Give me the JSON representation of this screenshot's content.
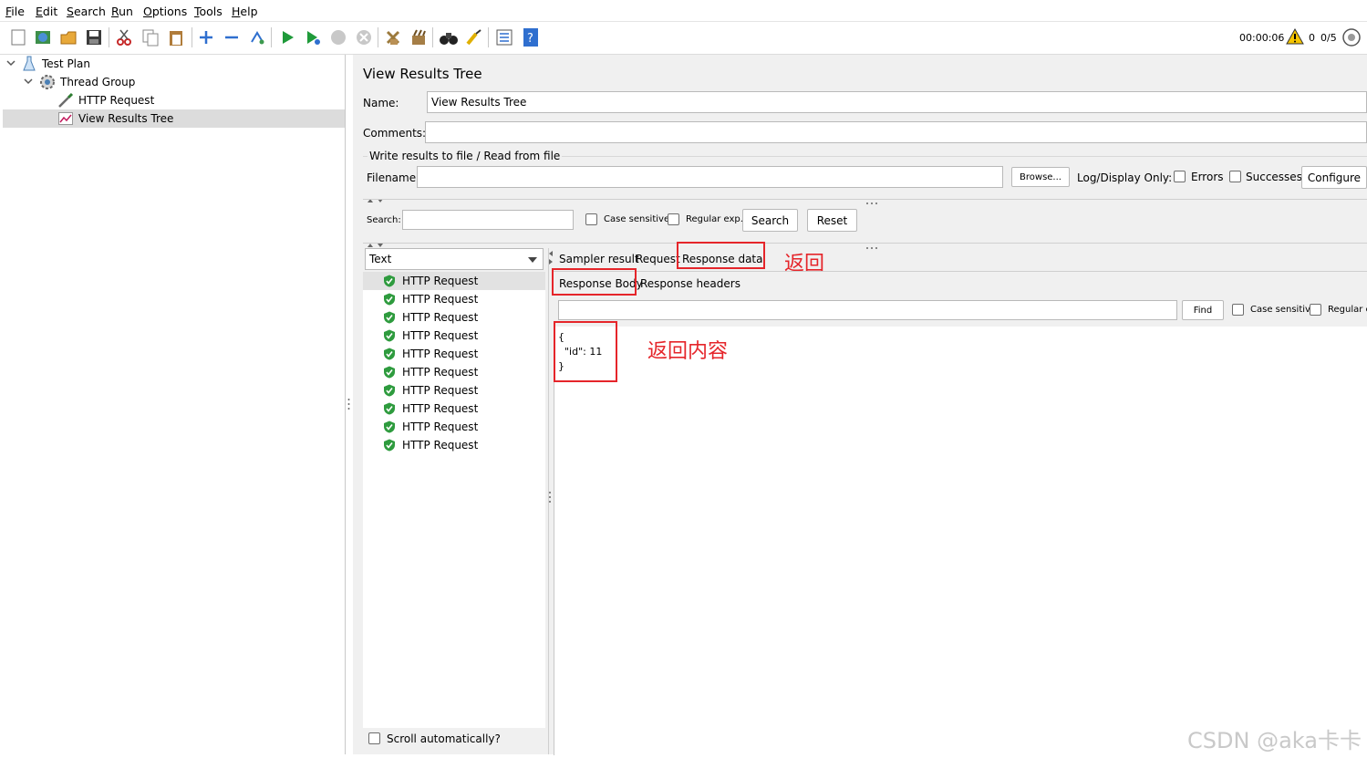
{
  "menubar": {
    "items": [
      {
        "label": "File",
        "ul": "F",
        "rest": "ile"
      },
      {
        "label": "Edit",
        "ul": "E",
        "rest": "dit"
      },
      {
        "label": "Search",
        "ul": "S",
        "rest": "earch"
      },
      {
        "label": "Run",
        "ul": "R",
        "rest": "un"
      },
      {
        "label": "Options",
        "ul": "O",
        "rest": "ptions"
      },
      {
        "label": "Tools",
        "ul": "T",
        "rest": "ools"
      },
      {
        "label": "Help",
        "ul": "H",
        "rest": "elp"
      }
    ]
  },
  "toolbar": {
    "timer": "00:00:06",
    "warnings": "0",
    "threads": "0/5"
  },
  "tree": {
    "items": [
      {
        "label": "Test Plan",
        "icon": "test-plan-icon"
      },
      {
        "label": "Thread Group",
        "icon": "gear-icon"
      },
      {
        "label": "HTTP Request",
        "icon": "pipette-icon"
      },
      {
        "label": "View Results Tree",
        "icon": "chart-icon"
      }
    ]
  },
  "panel": {
    "title": "View Results Tree",
    "name_label": "Name:",
    "name_value": "View Results Tree",
    "comments_label": "Comments:",
    "comments_value": "",
    "write_results_label": "Write results to file / Read from file",
    "filename_label": "Filename",
    "filename_value": "",
    "browse_label": "Browse...",
    "log_display_label": "Log/Display Only:",
    "errors_label": "Errors",
    "successes_label": "Successes",
    "configure_label": "Configure"
  },
  "search": {
    "label": "Search:",
    "value": "",
    "case_sensitive_label": "Case sensitive",
    "regex_label": "Regular exp.",
    "search_button": "Search",
    "reset_button": "Reset"
  },
  "renderer": {
    "selected": "Text"
  },
  "results": {
    "items": [
      "HTTP Request",
      "HTTP Request",
      "HTTP Request",
      "HTTP Request",
      "HTTP Request",
      "HTTP Request",
      "HTTP Request",
      "HTTP Request",
      "HTTP Request",
      "HTTP Request"
    ],
    "scroll_label": "Scroll automatically?"
  },
  "tabs": {
    "sampler_result": "Sampler result",
    "request": "Request",
    "response_data": "Response data",
    "response_body": "Response Body",
    "response_headers": "Response headers"
  },
  "find": {
    "value": "",
    "find_button": "Find",
    "case_sensitive_label": "Case sensitive",
    "regex_label": "Regular ex"
  },
  "response": {
    "line1": "{",
    "line2": "  \"id\": 11",
    "line3": "}"
  },
  "annotations": {
    "return_label": "返回",
    "return_content_label": "返回内容",
    "color": "#e5252a"
  },
  "watermark": "CSDN @aka卡卡"
}
